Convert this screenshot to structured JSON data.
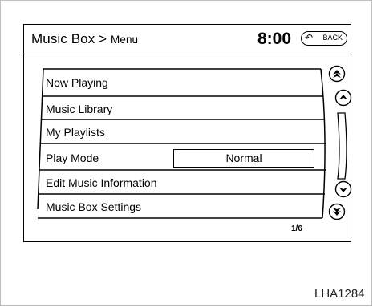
{
  "header": {
    "title": "Music Box >",
    "subtitle": "Menu",
    "time": "8:00",
    "back_label": "BACK"
  },
  "menu": {
    "items": [
      {
        "label": "Now Playing"
      },
      {
        "label": "Music Library"
      },
      {
        "label": "My Playlists"
      },
      {
        "label": "Play Mode",
        "value": "Normal"
      },
      {
        "label": "Edit Music Information"
      },
      {
        "label": "Music Box Settings"
      }
    ],
    "page_indicator": "1/6"
  },
  "scroll": {
    "icons": [
      "page-up-icon",
      "line-up-icon",
      "line-down-icon",
      "page-down-icon"
    ]
  },
  "figure_code": "LHA1284"
}
